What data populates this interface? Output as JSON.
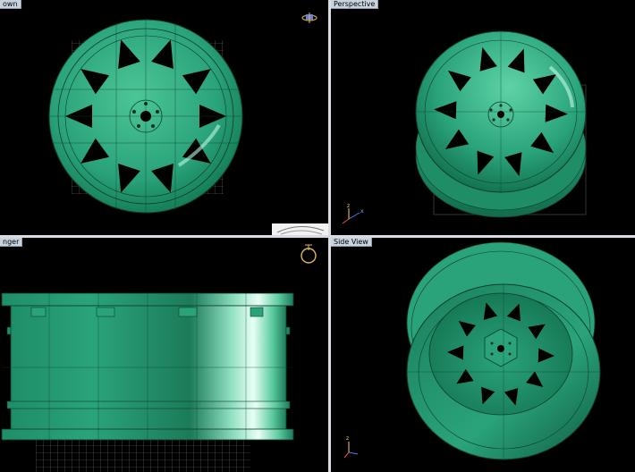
{
  "viewports": {
    "top_left": {
      "label": "own"
    },
    "top_right": {
      "label": "Perspective"
    },
    "bottom_left": {
      "label": "nger"
    },
    "bottom_right": {
      "label": "Side View"
    }
  },
  "colors": {
    "wheel_fill": "#2aa37b",
    "wheel_dark": "#177a57",
    "wheel_light": "#7fe6bf",
    "wire": "#0e3d2c",
    "grid": "#7a7a7a",
    "background": "#000000",
    "label_bg": "#c9d3df"
  },
  "icons": {
    "nav_gizmo": "orbit-gizmo-icon",
    "axis": "xyz-axis-triad-icon"
  }
}
